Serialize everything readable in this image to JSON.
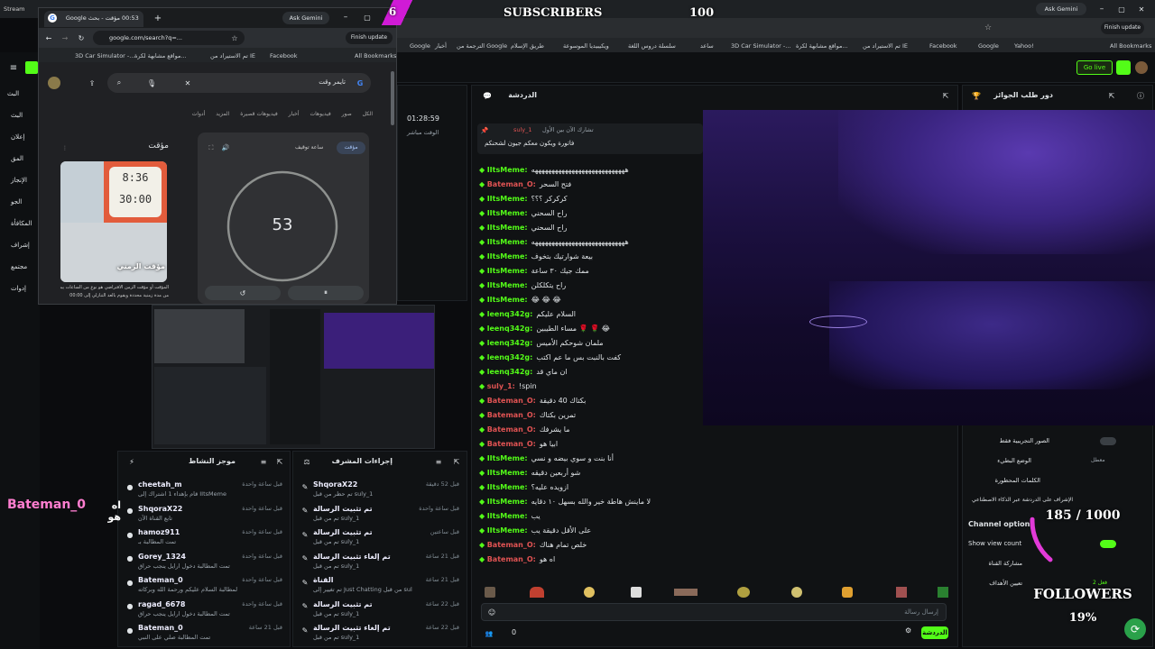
{
  "overlay": {
    "subscribers_label": "SUBSCRIBERS",
    "subscribers_count": "100",
    "badge_number": "6",
    "followers_label": "FOLLOWERS",
    "followers_count": "185 / 1000",
    "followers_percent": "19%",
    "followers_progress": 0.185,
    "name_tag": "Bateman_0",
    "name_tag_prefix": "اه هو"
  },
  "browser_back": {
    "tab_title": "Stream",
    "gemini": "Ask Gemini",
    "finish_update": "Finish update",
    "bookmarks": [
      "Google",
      "أخبار",
      "الترجمة من Google",
      "طريق الإسلام",
      "ويكيبيديا الموسوعة",
      "سلسلة دروس اللغة",
      "ساعد",
      "3D Car Simulator -...",
      "مواقع مشابهة لكرة...",
      "تم الاستيراد من IE",
      "Facebook",
      "Google",
      "Yahoo!"
    ],
    "all_bookmarks": "All Bookmarks"
  },
  "browser_front": {
    "tab_title": "مؤقت - بحث Google",
    "tab_time": "00:53",
    "url": "google.com/search?q=...",
    "gemini": "Ask Gemini",
    "finish_update": "Finish update",
    "bookmarks": [
      "3D Car Simulator -...",
      "مواقع مشابهة لكرة...",
      "تم الاستيراد من IE",
      "Facebook"
    ],
    "all_bookmarks": "All Bookmarks",
    "search_query": "تايمر وقت",
    "search_tabs": [
      "الكل",
      "صور",
      "فيديوهات",
      "أخبار",
      "فيديوهات قصيرة",
      "المزيد",
      "أدوات"
    ],
    "timer_tab_timer": "مؤقت",
    "timer_tab_stopwatch": "ساعة توقيف",
    "timer_value": "53",
    "kp_title": "مؤقت",
    "kp_caption": "مؤقت الزمني",
    "kp_text_1": "المؤقت أو مؤقت الزمن الافتراضي هو نوع من الساعات يبدأ",
    "kp_text_2": "من مدة زمنية محددة ويقوم بالعد التنازلي إلى 00:00"
  },
  "kick": {
    "chat_title": "الدردشة",
    "rewards_title": "دور طلب الجوائز",
    "go_live": "Go live",
    "stream_time": "01:28:59",
    "stream_time_label": "الوقت مباشر",
    "sidebar": [
      "البث",
      "البث",
      "إعلان",
      "المق",
      "الإنجاز",
      "الجو",
      "المكافأة",
      "إشراف",
      "مجتمع",
      "إدوات"
    ],
    "pinned_user": "suly_1",
    "pinned_text": "تشارك الآن بين الأول",
    "pinned_message": "فاتورة ويكون معكم جيون لشحنكم",
    "chat": [
      {
        "user": "IItsMeme:",
        "msg": "ههههههههههههههههههههههههههههه",
        "color": "#53fc18"
      },
      {
        "user": "Bateman_O:",
        "msg": "فتح السحر",
        "color": "#e05353"
      },
      {
        "user": "IItsMeme:",
        "msg": "كركركر ؟؟؟",
        "color": "#53fc18"
      },
      {
        "user": "IItsMeme:",
        "msg": "راح السحني",
        "color": "#53fc18"
      },
      {
        "user": "IItsMeme:",
        "msg": "راح السحني",
        "color": "#53fc18"
      },
      {
        "user": "IItsMeme:",
        "msg": "ههههههههههههههههههههههههههههه",
        "color": "#53fc18"
      },
      {
        "user": "IItsMeme:",
        "msg": "بيعة شوارتيك بتخوف",
        "color": "#53fc18"
      },
      {
        "user": "IItsMeme:",
        "msg": "ممك جيك ٣٠ ساعة",
        "color": "#53fc18"
      },
      {
        "user": "IItsMeme:",
        "msg": "راح يتكلكلن",
        "color": "#53fc18"
      },
      {
        "user": "IItsMeme:",
        "msg": "😂 😂 😂",
        "color": "#53fc18"
      },
      {
        "user": "leenq342g:",
        "msg": "السلام عليكم",
        "color": "#53fc18"
      },
      {
        "user": "leenq342g:",
        "msg": "مساء الطيبين 🌹 🌹 😂",
        "color": "#53fc18"
      },
      {
        "user": "leenq342g:",
        "msg": "ملمان شوحكم الأميس",
        "color": "#53fc18"
      },
      {
        "user": "leenq342g:",
        "msg": "كفت بالنبت بس ما عم اكتب",
        "color": "#53fc18"
      },
      {
        "user": "leenq342g:",
        "msg": "ان ماي قد",
        "color": "#53fc18"
      },
      {
        "user": "suly_1:",
        "msg": "!spin",
        "color": "#e05353"
      },
      {
        "user": "Bateman_O:",
        "msg": "بكتاك 40 دقيقة",
        "color": "#e05353"
      },
      {
        "user": "Bateman_O:",
        "msg": "تمرين بكتاك",
        "color": "#e05353"
      },
      {
        "user": "Bateman_O:",
        "msg": "ما يشرفك",
        "color": "#e05353"
      },
      {
        "user": "Bateman_O:",
        "msg": "ابيا هو",
        "color": "#e05353"
      },
      {
        "user": "IItsMeme:",
        "msg": "أنا بنت و سوي بيضه و نسي",
        "color": "#53fc18"
      },
      {
        "user": "IItsMeme:",
        "msg": "شو أربعين دقيقه",
        "color": "#53fc18"
      },
      {
        "user": "IItsMeme:",
        "msg": "ازويده عليه؟",
        "color": "#53fc18"
      },
      {
        "user": "IItsMeme:",
        "msg": "لا ماينش هاطة خير والله بسهل ١٠ دقايه",
        "color": "#53fc18"
      },
      {
        "user": "IItsMeme:",
        "msg": "يب",
        "color": "#53fc18"
      },
      {
        "user": "IItsMeme:",
        "msg": "على الأقل دقيقة يب",
        "color": "#53fc18"
      },
      {
        "user": "Bateman_O:",
        "msg": "خلص تمام هناك",
        "color": "#e05353"
      },
      {
        "user": "Bateman_O:",
        "msg": "اه هو",
        "color": "#e05353"
      }
    ],
    "chat_input_placeholder": "إرسال رسالة",
    "chat_send": "الدردشة",
    "viewer_count": "0",
    "activity_title": "موجز النشاط",
    "activity": [
      {
        "user": "cheetah_m",
        "sub": "قام بإهداء 1 اشتراك إلى IItsMeme",
        "time": "قبل ساعة واحدة"
      },
      {
        "user": "ShqoraX22",
        "sub": "تابع القناة الآن",
        "time": "قبل ساعة واحدة"
      },
      {
        "user": "hamoz911",
        "sub": "تمت المطالبة بـ",
        "time": "قبل ساعة واحدة"
      },
      {
        "user": "Gorey_1324",
        "sub": "تمت المطالبة دخول ارايل ينجب حراق",
        "time": "قبل ساعة واحدة"
      },
      {
        "user": "Bateman_0",
        "sub": "تمت المطالبة السلام عليكم ورحمة الله وبركاته",
        "time": "قبل ساعة واحدة"
      },
      {
        "user": "ragad_6678",
        "sub": "تمت المطالبة دخول ارايل ينجب حراق",
        "time": "قبل ساعة واحدة"
      },
      {
        "user": "Bateman_0",
        "sub": "تمت المطالبة صلي على النبي",
        "time": "قبل 21 ساعة"
      }
    ],
    "mod_title": "إجراءات المشرف",
    "mod": [
      {
        "user": "ShqoraX22",
        "sub": "تم حظر من قبل suly_1",
        "time": "قبل 52 دقيقة"
      },
      {
        "user": "تم تثبيت الرسالة",
        "sub": "تم من قبل suly_1",
        "time": "قبل ساعة واحدة"
      },
      {
        "user": "تم تثبيت الرسالة",
        "sub": "تم من قبل suly_1",
        "time": "قبل ساعتين"
      },
      {
        "user": "تم إلغاء تثبيت الرسالة",
        "sub": "تم من قبل suly_1",
        "time": "قبل 21 ساعة"
      },
      {
        "user": "القناة",
        "sub": "تم تغيير إلى Just Chatting من قبل suly_1",
        "time": "قبل 21 ساعة"
      },
      {
        "user": "تم تثبيت الرسالة",
        "sub": "تم من قبل suly_1",
        "time": "قبل 22 ساعة"
      },
      {
        "user": "تم إلغاء تثبيت الرسالة",
        "sub": "تم من قبل suly_1",
        "time": "قبل 22 ساعة"
      }
    ],
    "settings": {
      "sub_only": "الصور التجريبية فقط",
      "slow_mode": "الوضع البطيء",
      "slow_mode_value": "معطل",
      "banned_words": "الكلمات المحظورة",
      "ai_moderation": "الإشراف على الدردشة عبر الذكاء الاصطناعي",
      "channel_options": "Channel options",
      "show_view_count": "Show view count",
      "share_channel": "مشاركة القناة",
      "set_goals": "تعيين الأهداف",
      "goals_value": "فعل 2"
    }
  }
}
